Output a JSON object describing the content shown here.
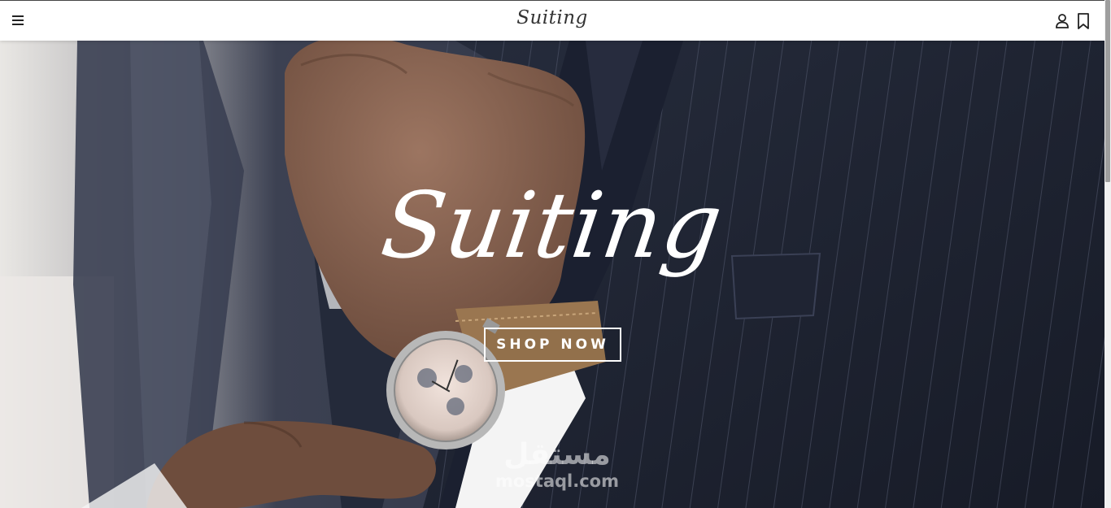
{
  "header": {
    "logo": "Suiting",
    "menu_icon": "hamburger-menu-icon",
    "account_icon": "user-icon",
    "bookmark_icon": "bookmark-icon"
  },
  "hero": {
    "title": "Suiting",
    "cta_label": "SHOP NOW",
    "image": "man-in-pinstripe-suit-adjusting-tie-with-wristwatch"
  },
  "watermark": {
    "arabic": "مستقل",
    "latin": "mostaql.com"
  },
  "colors": {
    "suit_navy": "#1e2332",
    "header_bg": "#ffffff",
    "cta_border": "#ffffff",
    "skin": "#8a6652",
    "watch_strap": "#9a7650"
  }
}
